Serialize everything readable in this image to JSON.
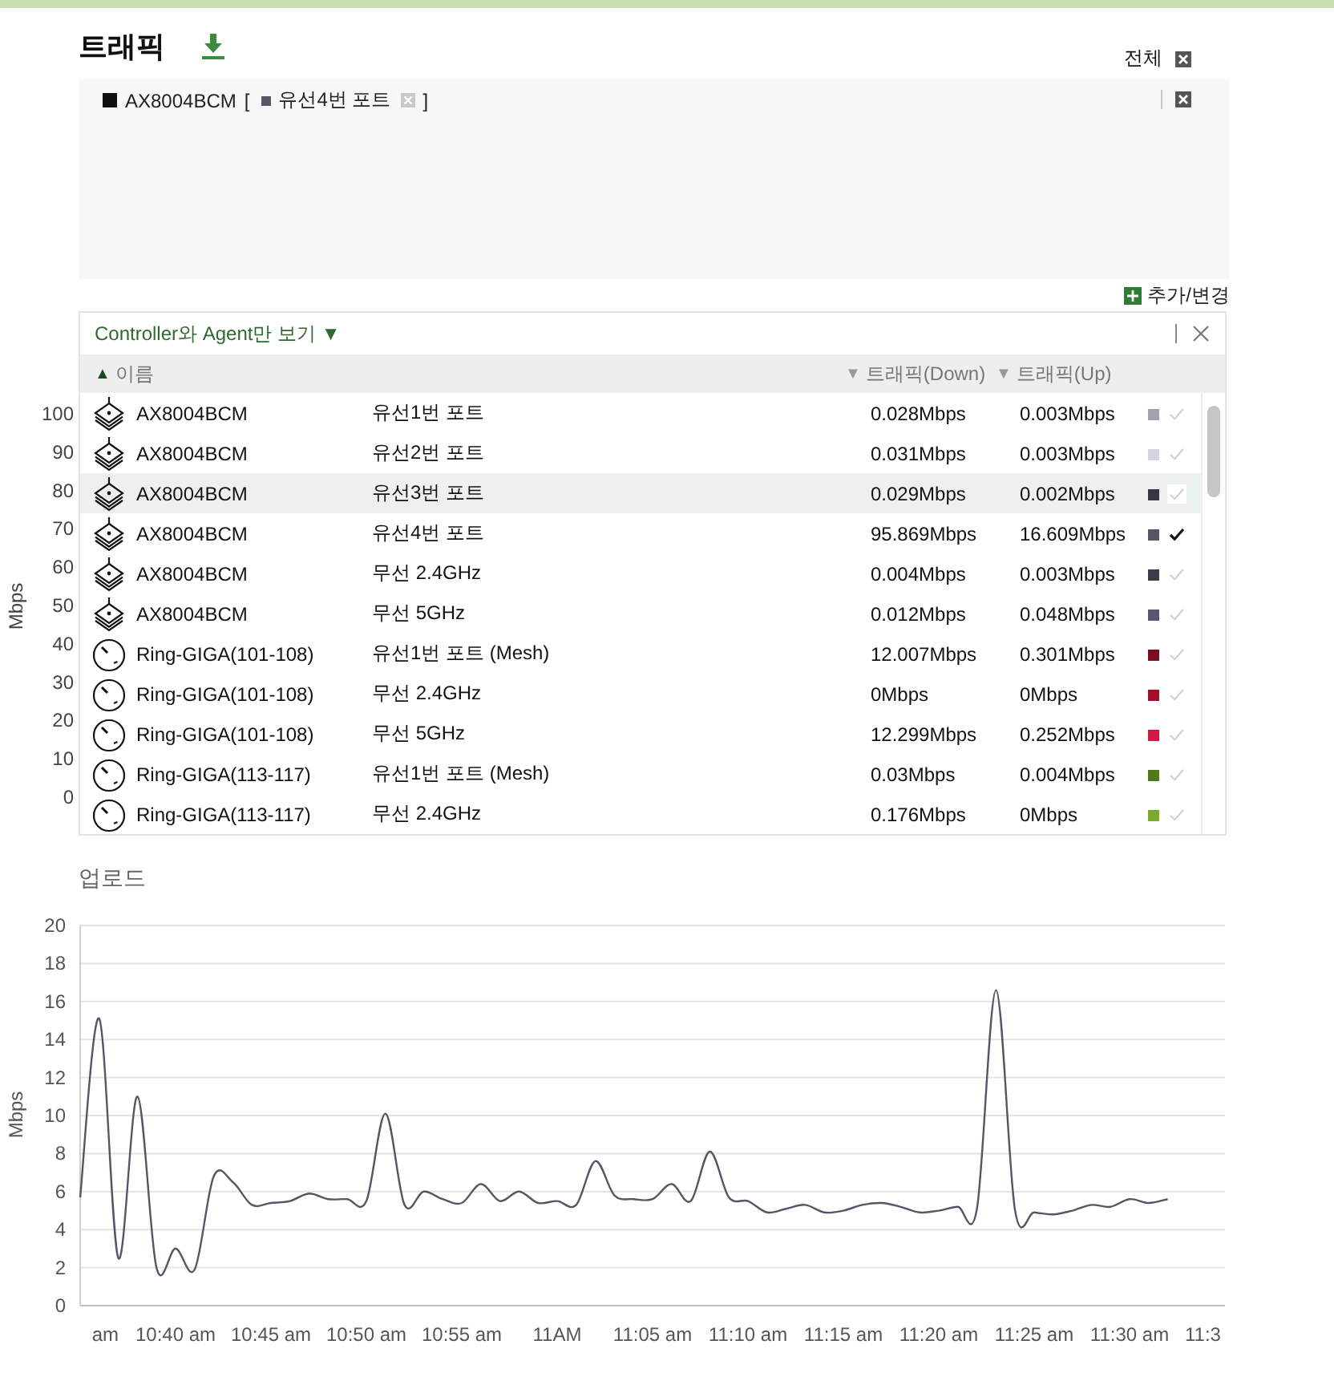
{
  "header": {
    "title": "트래픽",
    "clear_all_label": "전체"
  },
  "selection": {
    "devices": [
      {
        "name": "AX8004BCM",
        "color": "#111111",
        "open": "[",
        "ports": [
          {
            "name": "유선4번 포트",
            "color": "#555566"
          }
        ],
        "close": "]"
      }
    ]
  },
  "add_change": {
    "label": "추가/변경"
  },
  "download_chart_axis": {
    "label": "Mbps",
    "ticks": [
      "100",
      "90",
      "80",
      "70",
      "60",
      "50",
      "40",
      "30",
      "20",
      "10",
      "0"
    ]
  },
  "device_table": {
    "filter": "Controller와 Agent만 보기 ▼",
    "columns": [
      {
        "label": "이름",
        "sort_mark": "▲",
        "selected": true
      },
      {
        "label": "트래픽(Down)",
        "sort_mark": "▼",
        "selected": false
      },
      {
        "label": "트래픽(Up)",
        "sort_mark": "▼",
        "selected": false
      }
    ],
    "rows": [
      {
        "kind": "router",
        "name": "AX8004BCM",
        "port": "유선1번 포트",
        "down": "0.028Mbps",
        "up": "0.003Mbps",
        "color": "#a2a1ae",
        "checked": false,
        "highlighted": false
      },
      {
        "kind": "router",
        "name": "AX8004BCM",
        "port": "유선2번 포트",
        "down": "0.031Mbps",
        "up": "0.003Mbps",
        "color": "#d4d3e0",
        "checked": false,
        "highlighted": false
      },
      {
        "kind": "router",
        "name": "AX8004BCM",
        "port": "유선3번 포트",
        "down": "0.029Mbps",
        "up": "0.002Mbps",
        "color": "#363742",
        "checked": false,
        "highlighted": true
      },
      {
        "kind": "router",
        "name": "AX8004BCM",
        "port": "유선4번 포트",
        "down": "95.869Mbps",
        "up": "16.609Mbps",
        "color": "#555566",
        "checked": true,
        "highlighted": false
      },
      {
        "kind": "router",
        "name": "AX8004BCM",
        "port": "무선 2.4GHz",
        "down": "0.004Mbps",
        "up": "0.003Mbps",
        "color": "#3a3c47",
        "checked": false,
        "highlighted": false
      },
      {
        "kind": "router",
        "name": "AX8004BCM",
        "port": "무선 5GHz",
        "down": "0.012Mbps",
        "up": "0.048Mbps",
        "color": "#585869",
        "checked": false,
        "highlighted": false
      },
      {
        "kind": "ring",
        "name": "Ring-GIGA(101-108)",
        "port": "유선1번 포트 (Mesh)",
        "down": "12.007Mbps",
        "up": "0.301Mbps",
        "color": "#7b0c22",
        "checked": false,
        "highlighted": false
      },
      {
        "kind": "ring",
        "name": "Ring-GIGA(101-108)",
        "port": "무선 2.4GHz",
        "down": "0Mbps",
        "up": "0Mbps",
        "color": "#a30e28",
        "checked": false,
        "highlighted": false
      },
      {
        "kind": "ring",
        "name": "Ring-GIGA(101-108)",
        "port": "무선 5GHz",
        "down": "12.299Mbps",
        "up": "0.252Mbps",
        "color": "#d4173f",
        "checked": false,
        "highlighted": false
      },
      {
        "kind": "ring",
        "name": "Ring-GIGA(113-117)",
        "port": "유선1번 포트 (Mesh)",
        "down": "0.03Mbps",
        "up": "0.004Mbps",
        "color": "#4e7a1c",
        "checked": false,
        "highlighted": false
      },
      {
        "kind": "ring",
        "name": "Ring-GIGA(113-117)",
        "port": "무선 2.4GHz",
        "down": "0.176Mbps",
        "up": "0Mbps",
        "color": "#7cab2b",
        "checked": false,
        "highlighted": false
      }
    ]
  },
  "upload": {
    "cut_x_label_left": "am",
    "cut_x_label_right": "11:3",
    "chart_data": {
      "type": "line",
      "title": "업로드",
      "ylabel": "Mbps",
      "ylim": [
        0,
        20
      ],
      "yticks": [
        0,
        2,
        4,
        6,
        8,
        10,
        12,
        14,
        16,
        18,
        20
      ],
      "grid": true,
      "categories": [
        null,
        null,
        null,
        null,
        null,
        "10:40 am",
        null,
        null,
        null,
        null,
        "10:45 am",
        null,
        null,
        null,
        null,
        "10:50 am",
        null,
        null,
        null,
        null,
        "10:55 am",
        null,
        null,
        null,
        null,
        "11AM",
        null,
        null,
        null,
        null,
        "11:05 am",
        null,
        null,
        null,
        null,
        "11:10 am",
        null,
        null,
        null,
        null,
        "11:15 am",
        null,
        null,
        null,
        null,
        "11:20 am",
        null,
        null,
        null,
        null,
        "11:25 am",
        null,
        null,
        null,
        null,
        "11:30 am",
        null,
        null,
        null,
        null,
        null
      ],
      "series": [
        {
          "color": "#555566",
          "values": [
            5.7,
            15.1,
            2.5,
            11.0,
            2.0,
            3.0,
            1.9,
            6.8,
            6.5,
            5.3,
            5.4,
            5.5,
            5.9,
            5.6,
            5.6,
            5.5,
            10.1,
            5.3,
            6.0,
            5.6,
            5.4,
            6.4,
            5.5,
            6.0,
            5.4,
            5.5,
            5.3,
            7.6,
            5.8,
            5.6,
            5.6,
            6.4,
            5.5,
            8.1,
            5.7,
            5.5,
            4.9,
            5.1,
            5.3,
            4.9,
            5.0,
            5.3,
            5.4,
            5.2,
            4.9,
            5.0,
            5.2,
            5.1,
            16.6,
            5.0,
            4.9,
            4.8,
            5.0,
            5.3,
            5.2,
            5.6,
            5.4,
            5.6,
            null,
            null,
            null
          ]
        }
      ]
    }
  }
}
